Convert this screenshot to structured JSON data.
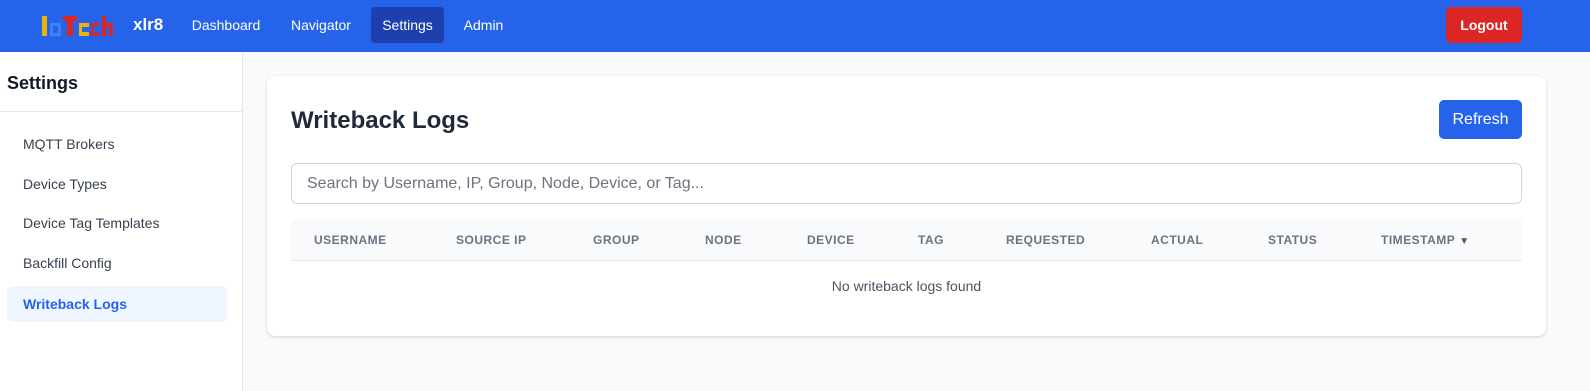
{
  "header": {
    "logo_text": "IoTech",
    "brand": "xlr8",
    "nav": [
      {
        "label": "Dashboard"
      },
      {
        "label": "Navigator"
      },
      {
        "label": "Settings"
      },
      {
        "label": "Admin"
      }
    ],
    "active_nav": "Settings",
    "logout_label": "Logout"
  },
  "sidebar": {
    "title": "Settings",
    "items": [
      {
        "label": "MQTT Brokers"
      },
      {
        "label": "Device Types"
      },
      {
        "label": "Device Tag Templates"
      },
      {
        "label": "Backfill Config"
      },
      {
        "label": "Writeback Logs"
      }
    ],
    "active_item": "Writeback Logs"
  },
  "main": {
    "title": "Writeback Logs",
    "refresh_label": "Refresh",
    "search": {
      "placeholder": "Search by Username, IP, Group, Node, Device, or Tag...",
      "value": ""
    },
    "table": {
      "columns": [
        "USERNAME",
        "SOURCE IP",
        "GROUP",
        "NODE",
        "DEVICE",
        "TAG",
        "REQUESTED",
        "ACTUAL",
        "STATUS",
        "TIMESTAMP"
      ],
      "sort_column": "TIMESTAMP",
      "sort_direction": "descending",
      "sort_indicator": "▼",
      "rows": [],
      "empty_message": "No writeback logs found"
    }
  },
  "colors": {
    "primary": "#2563eb",
    "active_nav": "#1e40af",
    "danger": "#dc2626",
    "sidebar_active_bg": "#eff6ff"
  }
}
